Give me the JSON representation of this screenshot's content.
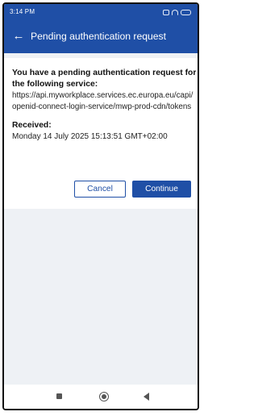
{
  "status_bar": {
    "time": "3:14 PM"
  },
  "app_bar": {
    "back_icon": "←",
    "title": "Pending authentication request"
  },
  "request": {
    "heading": "You have a pending authentication request for the following service:",
    "service_url": "https://api.myworkplace.services.ec.europa.eu/capi/openid-connect-login-service/mwp-prod-cdn/tokens",
    "received_label": "Received:",
    "received_value": "Monday 14 July 2025 15:13:51 GMT+02:00"
  },
  "actions": {
    "cancel_label": "Cancel",
    "continue_label": "Continue"
  },
  "colors": {
    "primary": "#1f4fa6",
    "background": "#eef1f5",
    "card": "#ffffff"
  },
  "nav_icons": [
    "recents-icon",
    "home-icon",
    "back-triangle-icon"
  ]
}
